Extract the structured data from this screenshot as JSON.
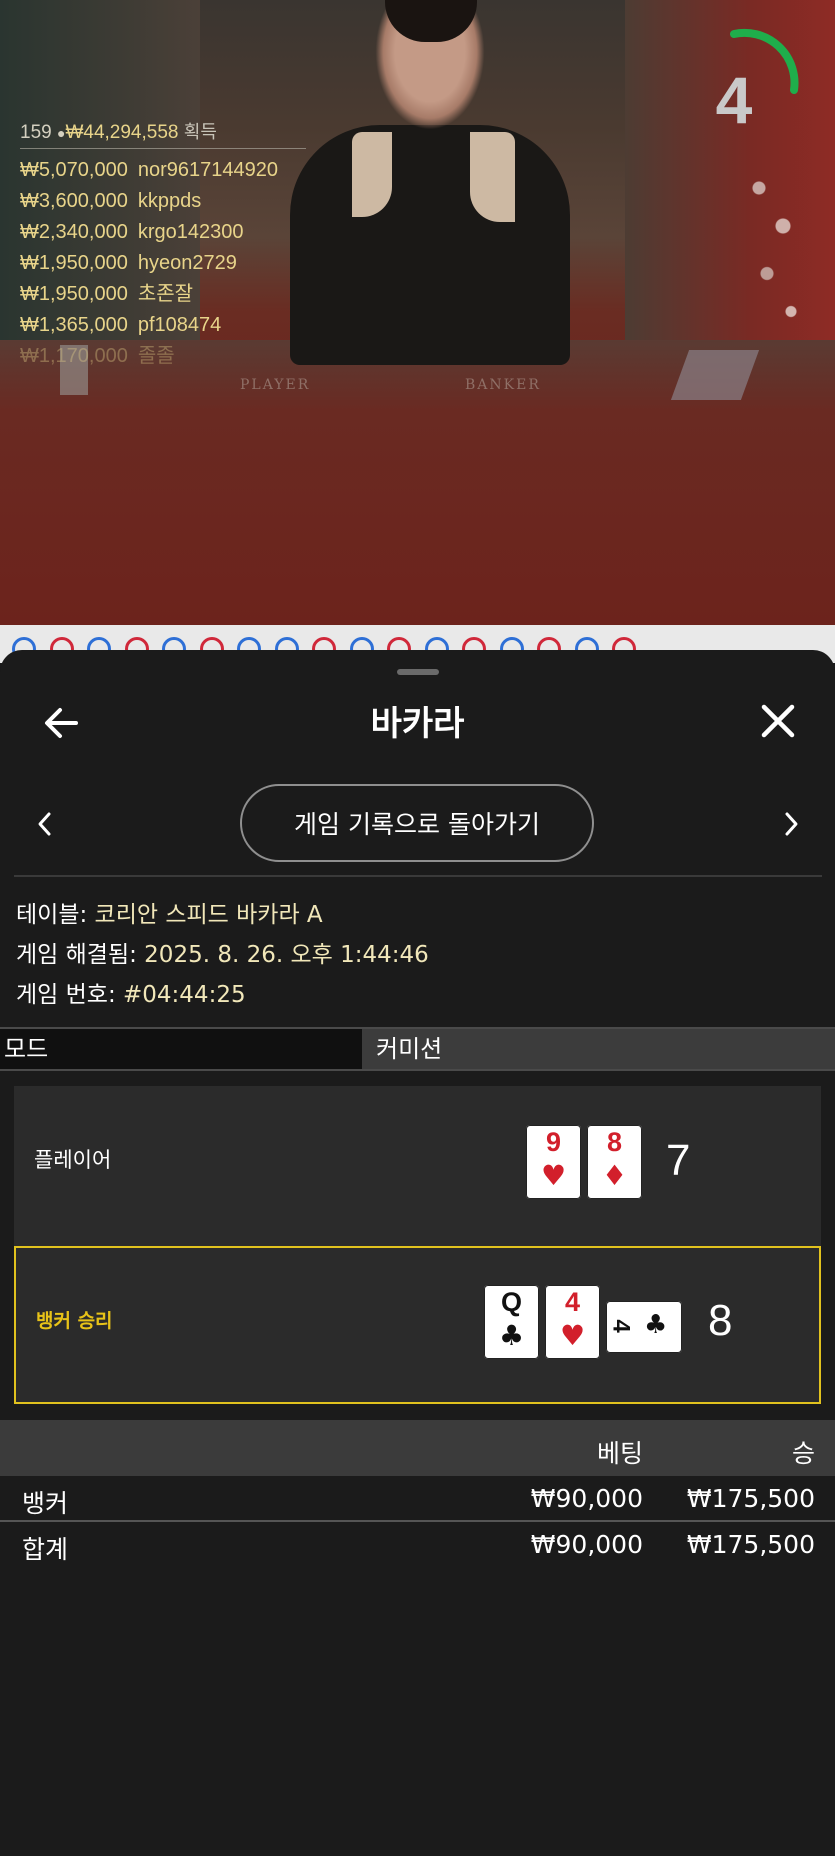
{
  "live_video": {
    "felt_labels": {
      "player": "PLAYER",
      "banker": "BANKER"
    },
    "stats": {
      "player_count": "159",
      "total_amount": "₩44,294,558",
      "label": "획득"
    },
    "winners": [
      {
        "amount": "₩5,070,000",
        "name": "nor9617144920"
      },
      {
        "amount": "₩3,600,000",
        "name": "kkppds"
      },
      {
        "amount": "₩2,340,000",
        "name": "krgo142300"
      },
      {
        "amount": "₩1,950,000",
        "name": "hyeon2729"
      },
      {
        "amount": "₩1,950,000",
        "name": "초존잘"
      },
      {
        "amount": "₩1,365,000",
        "name": "pf108474"
      },
      {
        "amount": "₩1,170,000",
        "name": "졸졸"
      }
    ],
    "countdown": "4",
    "colors": {
      "timer_arc": "#1fae4b",
      "player_blue": "#2e6fd6",
      "banker_red": "#d0283a"
    }
  },
  "road_strip": [
    "blue",
    "red",
    "blue",
    "red",
    "blue",
    "red",
    "blue",
    "blue",
    "red",
    "blue",
    "red",
    "blue",
    "red",
    "blue",
    "red",
    "blue",
    "red"
  ],
  "sheet": {
    "title": "바카라",
    "back_icon": "arrow-left-icon",
    "close_icon": "close-icon",
    "history_button": "게임 기록으로 돌아가기",
    "info": {
      "table_label": "테이블: ",
      "table_value": "코리안 스피드 바카라 A",
      "resolved_label": "게임 해결됨: ",
      "resolved_value": "2025. 8. 26. 오후 1:44:46",
      "number_label": "게임 번호: ",
      "number_value": "#04:44:25"
    },
    "tabs": {
      "mode": "모드",
      "commission": "커미션"
    },
    "result": {
      "player": {
        "label": "플레이어",
        "total": "7",
        "cards": [
          {
            "rank": "9",
            "suit": "♥",
            "color": "red"
          },
          {
            "rank": "8",
            "suit": "♦",
            "color": "red"
          }
        ]
      },
      "banker": {
        "label": "뱅커 승리",
        "total": "8",
        "cards": [
          {
            "rank": "Q",
            "suit": "♣",
            "color": "black"
          },
          {
            "rank": "4",
            "suit": "♥",
            "color": "red"
          },
          {
            "rank": "4",
            "suit": "♣",
            "color": "black"
          }
        ]
      }
    },
    "bets": {
      "headers": {
        "bet": "베팅",
        "win": "승"
      },
      "rows": [
        {
          "name": "뱅커",
          "bet": "₩90,000",
          "win": "₩175,500"
        }
      ],
      "total": {
        "name": "합계",
        "bet": "₩90,000",
        "win": "₩175,500"
      }
    },
    "accent_color": "#e1c21e"
  }
}
